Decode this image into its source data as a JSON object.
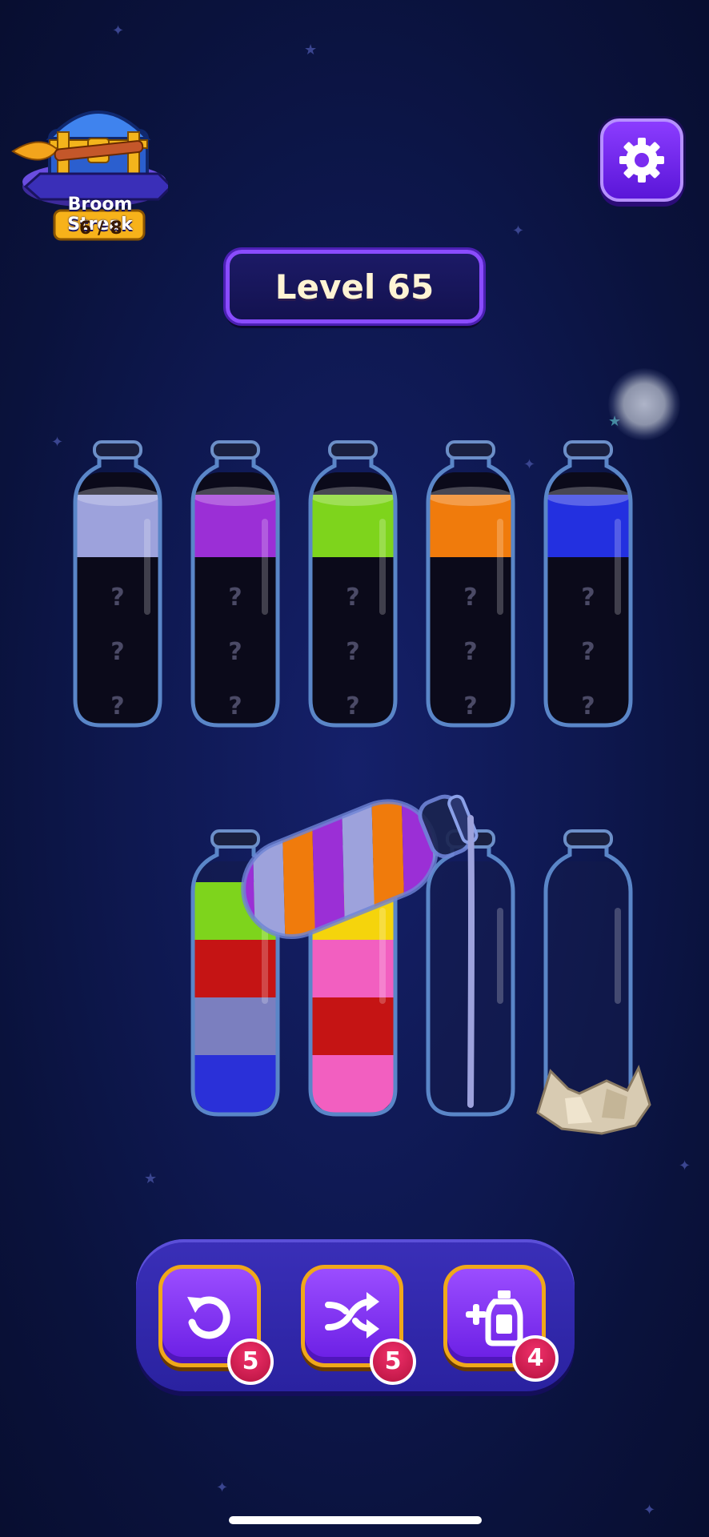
{
  "streak": {
    "title": "Broom Streak",
    "count": "6 / 8"
  },
  "level": {
    "label": "Level 65"
  },
  "tubes_top": [
    {
      "top_color": "#9da2dc",
      "hidden_marks": [
        "?",
        "?",
        "?"
      ]
    },
    {
      "top_color": "#9b2fd6",
      "hidden_marks": [
        "?",
        "?",
        "?"
      ]
    },
    {
      "top_color": "#7ed41c",
      "hidden_marks": [
        "?",
        "?",
        "?"
      ]
    },
    {
      "top_color": "#f07b0c",
      "hidden_marks": [
        "?",
        "?",
        "?"
      ]
    },
    {
      "top_color": "#2330e0",
      "hidden_marks": [
        "?",
        "?",
        "?"
      ]
    }
  ],
  "tubes_bottom": [
    {
      "layers": [
        "#2a30d8",
        "#7b7fbf",
        "#c51414",
        "#7ed41c"
      ]
    },
    {
      "layers": [
        "#f25fc0",
        "#c51414",
        "#f25fc0",
        "#f5d40c"
      ]
    },
    {
      "layers": [],
      "receiving_color": "#9da2dc"
    },
    {
      "layers": [],
      "locked_by": "rock-icon"
    }
  ],
  "pouring_tube": {
    "stripes": [
      "#9da2dc",
      "#f07b0c",
      "#9b2fd6"
    ]
  },
  "powerups": [
    {
      "icon": "undo-icon",
      "count": "5"
    },
    {
      "icon": "shuffle-icon",
      "count": "5"
    },
    {
      "icon": "add-bottle-icon",
      "count": "4"
    }
  ]
}
